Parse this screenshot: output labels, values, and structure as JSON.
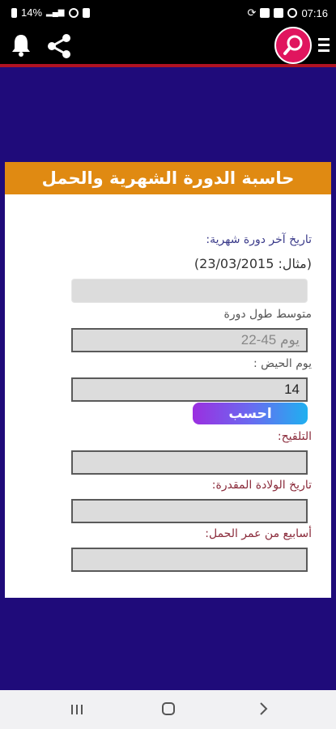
{
  "status": {
    "battery": "14%",
    "time": "07:16"
  },
  "header": {
    "title": "حاسبة الدورة الشهرية والحمل"
  },
  "form": {
    "last_period_label": "تاريخ آخر دورة شهرية:",
    "example_text": "(مثال: 23/03/2015)",
    "last_period_value": "",
    "cycle_label": "متوسط طول دورة",
    "cycle_placeholder": "22-45 يوم",
    "period_days_label": "يوم الحيض :",
    "period_days_value": "14",
    "calculate_label": "احسب",
    "ovulation_label": "التلقيح:",
    "ovulation_value": "",
    "due_date_label": "تاريخ الولادة المقدرة:",
    "due_date_value": "",
    "weeks_label": "أسابيع من عمر الحمل:",
    "weeks_value": ""
  },
  "colors": {
    "background": "#1f0b7a",
    "header": "#e08a12",
    "accent": "#e0155e"
  },
  "icons": [
    "bell-icon",
    "share-icon",
    "search-icon",
    "menu-icon",
    "recent-apps-icon",
    "home-icon",
    "back-icon"
  ]
}
